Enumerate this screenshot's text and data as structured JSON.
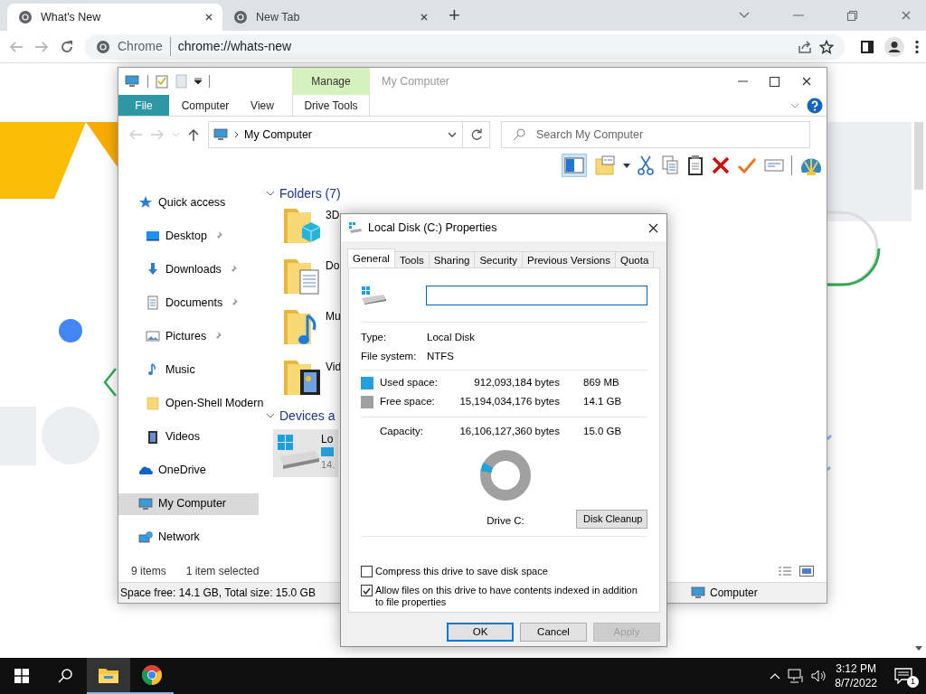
{
  "browser": {
    "tabs": [
      {
        "title": "What's New",
        "selected": true
      },
      {
        "title": "New Tab",
        "selected": false
      }
    ],
    "new_tab_button": "+",
    "omnibox": {
      "site": "Chrome",
      "url": "chrome://whats-new"
    }
  },
  "explorer": {
    "title": "My Computer",
    "context_group": "Manage",
    "ribbon_tabs": [
      {
        "label": "File",
        "kind": "file"
      },
      {
        "label": "Computer",
        "kind": "plain"
      },
      {
        "label": "View",
        "kind": "plain"
      },
      {
        "label": "Drive Tools",
        "kind": "context"
      }
    ],
    "address": "My Computer",
    "search": {
      "placeholder": "Search My Computer"
    },
    "nav": [
      {
        "label": "Quick access",
        "kind": "quick",
        "selected": false,
        "children": [
          {
            "label": "Desktop",
            "kind": "desktop",
            "pinned": true
          },
          {
            "label": "Downloads",
            "kind": "downloads",
            "pinned": true
          },
          {
            "label": "Documents",
            "kind": "documents",
            "pinned": true
          },
          {
            "label": "Pictures",
            "kind": "pictures",
            "pinned": true
          },
          {
            "label": "Music",
            "kind": "music",
            "pinned": false
          },
          {
            "label": "Open-Shell Modern",
            "kind": "folder",
            "pinned": false
          },
          {
            "label": "Videos",
            "kind": "videos",
            "pinned": false
          }
        ]
      },
      {
        "label": "OneDrive",
        "kind": "cloud",
        "selected": false
      },
      {
        "label": "My Computer",
        "kind": "computer",
        "selected": true
      },
      {
        "label": "Network",
        "kind": "network",
        "selected": false
      }
    ],
    "folders_header": "Folders (7)",
    "folders": [
      {
        "name": "3D",
        "kind": "objects"
      },
      {
        "name": "Do",
        "kind": "documents"
      },
      {
        "name": "Mu",
        "kind": "music"
      },
      {
        "name": "Vid",
        "kind": "videos"
      }
    ],
    "devices_header": "Devices a",
    "devices": [
      {
        "name": "Lo",
        "detail": "14.",
        "selected": true
      }
    ],
    "status": {
      "count": "9 items",
      "selection": "1 item selected"
    },
    "details_bar": {
      "space": "Space free: 14.1 GB, Total size: 15.0 GB",
      "location": "Computer"
    }
  },
  "dialog": {
    "title": "Local Disk (C:) Properties",
    "tabs": [
      {
        "label": "General",
        "selected": true
      },
      {
        "label": "Tools",
        "selected": false
      },
      {
        "label": "Sharing",
        "selected": false
      },
      {
        "label": "Security",
        "selected": false
      },
      {
        "label": "Previous Versions",
        "selected": false
      },
      {
        "label": "Quota",
        "selected": false
      }
    ],
    "info": [
      {
        "label": "Type:",
        "value": "Local Disk"
      },
      {
        "label": "File system:",
        "value": "NTFS"
      }
    ],
    "space": [
      {
        "label": "Used space:",
        "bytes": "912,093,184 bytes",
        "size": "869 MB",
        "color": "#26a0da"
      },
      {
        "label": "Free space:",
        "bytes": "15,194,034,176 bytes",
        "size": "14.1 GB",
        "color": "#a0a0a0"
      }
    ],
    "capacity": {
      "label": "Capacity:",
      "bytes": "16,106,127,360 bytes",
      "size": "15.0 GB"
    },
    "usage": {
      "level": 0.057
    },
    "drive_label": "Drive C:",
    "cleanup_button": "Disk Cleanup",
    "options": [
      {
        "label": "Compress this drive to save disk space",
        "checked": false
      },
      {
        "label": "Allow files on this drive to have contents indexed in addition to file properties",
        "checked": true
      }
    ],
    "buttons": [
      {
        "label": "OK",
        "kind": "default",
        "disabled": false
      },
      {
        "label": "Cancel",
        "kind": "plain",
        "disabled": false
      },
      {
        "label": "Apply",
        "kind": "plain",
        "disabled": true
      }
    ]
  },
  "taskbar": {
    "time": "3:12 PM",
    "date": "8/7/2022",
    "notifications": "1"
  }
}
